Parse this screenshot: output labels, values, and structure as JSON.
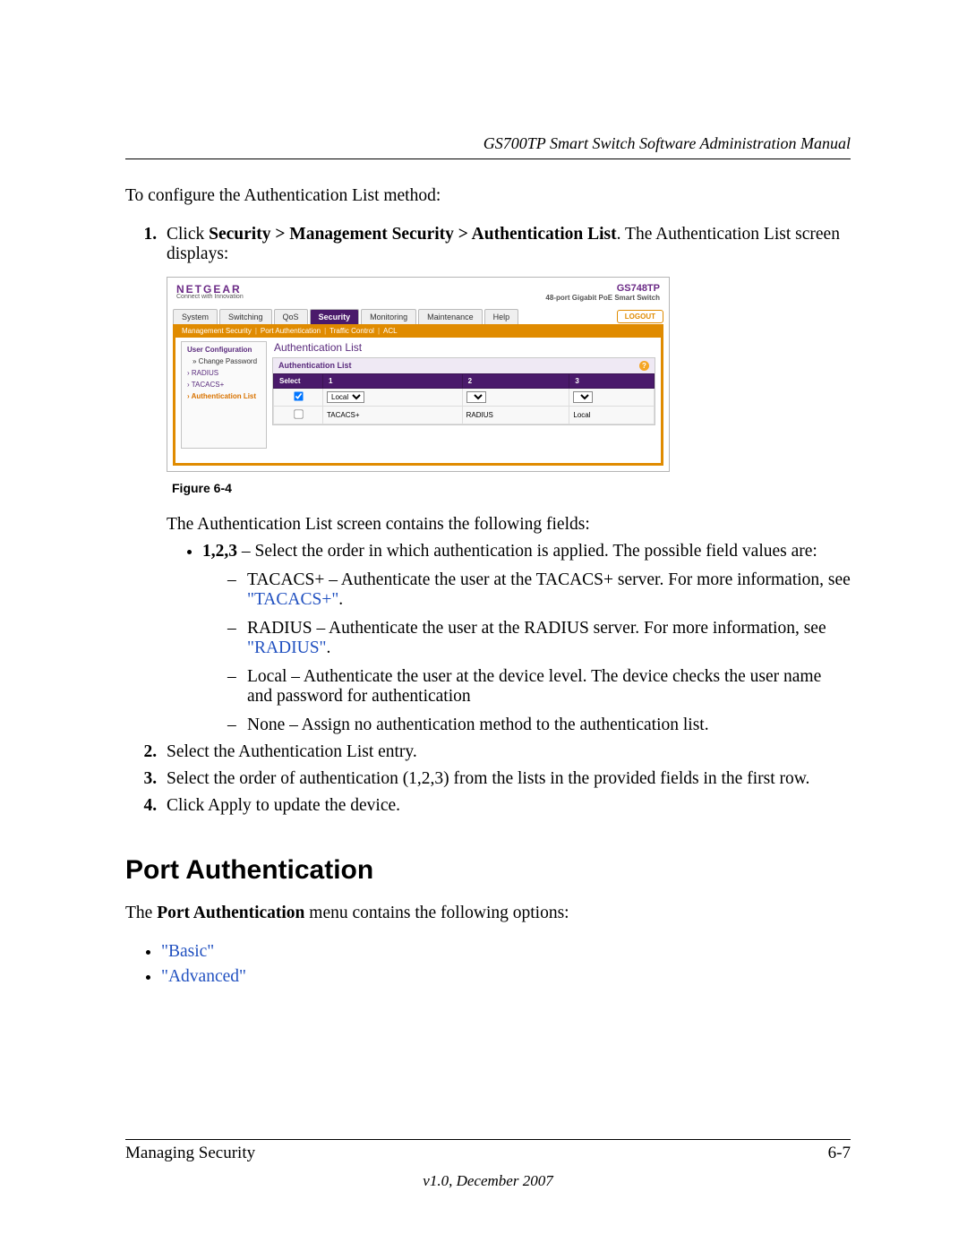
{
  "header": {
    "doc_title": "GS700TP Smart Switch Software Administration Manual"
  },
  "intro": "To configure the Authentication List method:",
  "step1": {
    "prefix": "Click ",
    "path": "Security > Management Security > Authentication List",
    "suffix": ". The Authentication List screen displays:"
  },
  "figure_caption": "Figure 6-4",
  "screenshot": {
    "brand": "NETGEAR",
    "brand_sub": "Connect with Innovation",
    "model": "GS748TP",
    "model_sub": "48-port Gigabit PoE Smart Switch",
    "tabs": [
      "System",
      "Switching",
      "QoS",
      "Security",
      "Monitoring",
      "Maintenance",
      "Help"
    ],
    "active_tab": "Security",
    "logout": "LOGOUT",
    "subnav": [
      "Management Security",
      "Port Authentication",
      "Traffic Control",
      "ACL"
    ],
    "sidebar": {
      "group": "User Configuration",
      "items": [
        "Change Password",
        "RADIUS",
        "TACACS+",
        "Authentication List"
      ],
      "active": "Authentication List"
    },
    "panel_title": "Authentication List",
    "panel_head": "Authentication List",
    "cols": [
      "Select",
      "1",
      "2",
      "3"
    ],
    "row1": {
      "c1_selected": "Local"
    },
    "row2": {
      "c1": "TACACS+",
      "c2": "RADIUS",
      "c3": "Local"
    }
  },
  "fields_intro": "The Authentication List screen contains the following fields:",
  "bullet_123": " – Select the order in which authentication is applied. The possible field values are:",
  "bullet_123_label": "1,2,3",
  "dash_tacacs_text": "TACACS+ – Authenticate the user at the TACACS+ server. For more information, see ",
  "dash_tacacs_link": "\"TACACS+\"",
  "dash_radius_text": "RADIUS – Authenticate the user at the RADIUS server. For more information, see ",
  "dash_radius_link": "\"RADIUS\"",
  "dash_local": "Local – Authenticate the user at the device level. The device checks the user name and password for authentication",
  "dash_none": "None – Assign no authentication method to the authentication list.",
  "step2": "Select the Authentication List entry.",
  "step3": "Select the order of authentication (1,2,3) from the lists in the provided fields in the first row.",
  "step4": "Click Apply to update the device.",
  "section_heading": "Port Authentication",
  "port_auth_intro_prefix": "The ",
  "port_auth_intro_bold": "Port Authentication",
  "port_auth_intro_suffix": " menu contains the following options:",
  "port_options": {
    "basic": "\"Basic\"",
    "advanced": "\"Advanced\""
  },
  "footer": {
    "left": "Managing Security",
    "right": "6-7",
    "version": "v1.0, December 2007"
  }
}
